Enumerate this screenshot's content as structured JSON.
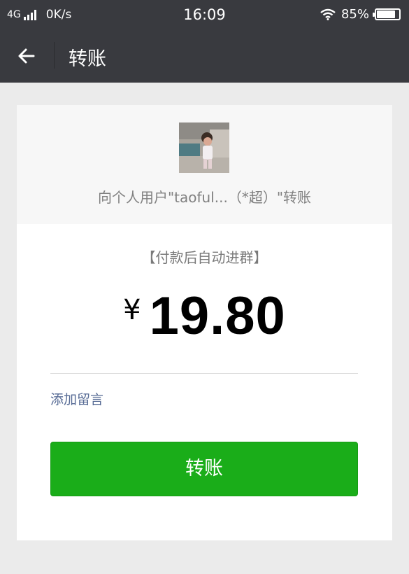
{
  "status_bar": {
    "network": "4G",
    "speed": "0K/s",
    "time": "16:09",
    "battery": "85%",
    "battery_level": 0.85,
    "icons": [
      "signal-icon",
      "wifi-icon",
      "battery-icon"
    ]
  },
  "nav": {
    "title": "转账",
    "back_icon": "back-arrow-icon"
  },
  "transfer": {
    "recipient_text": "向个人用户\"taoful...（*超）\"转账",
    "note": "【付款后自动进群】",
    "currency_symbol": "¥",
    "amount": "19.80",
    "add_message": "添加留言",
    "confirm_label": "转账"
  },
  "colors": {
    "nav_bg": "#393a3f",
    "page_bg": "#ebebeb",
    "primary_button": "#1aad19",
    "link": "#576b95"
  }
}
